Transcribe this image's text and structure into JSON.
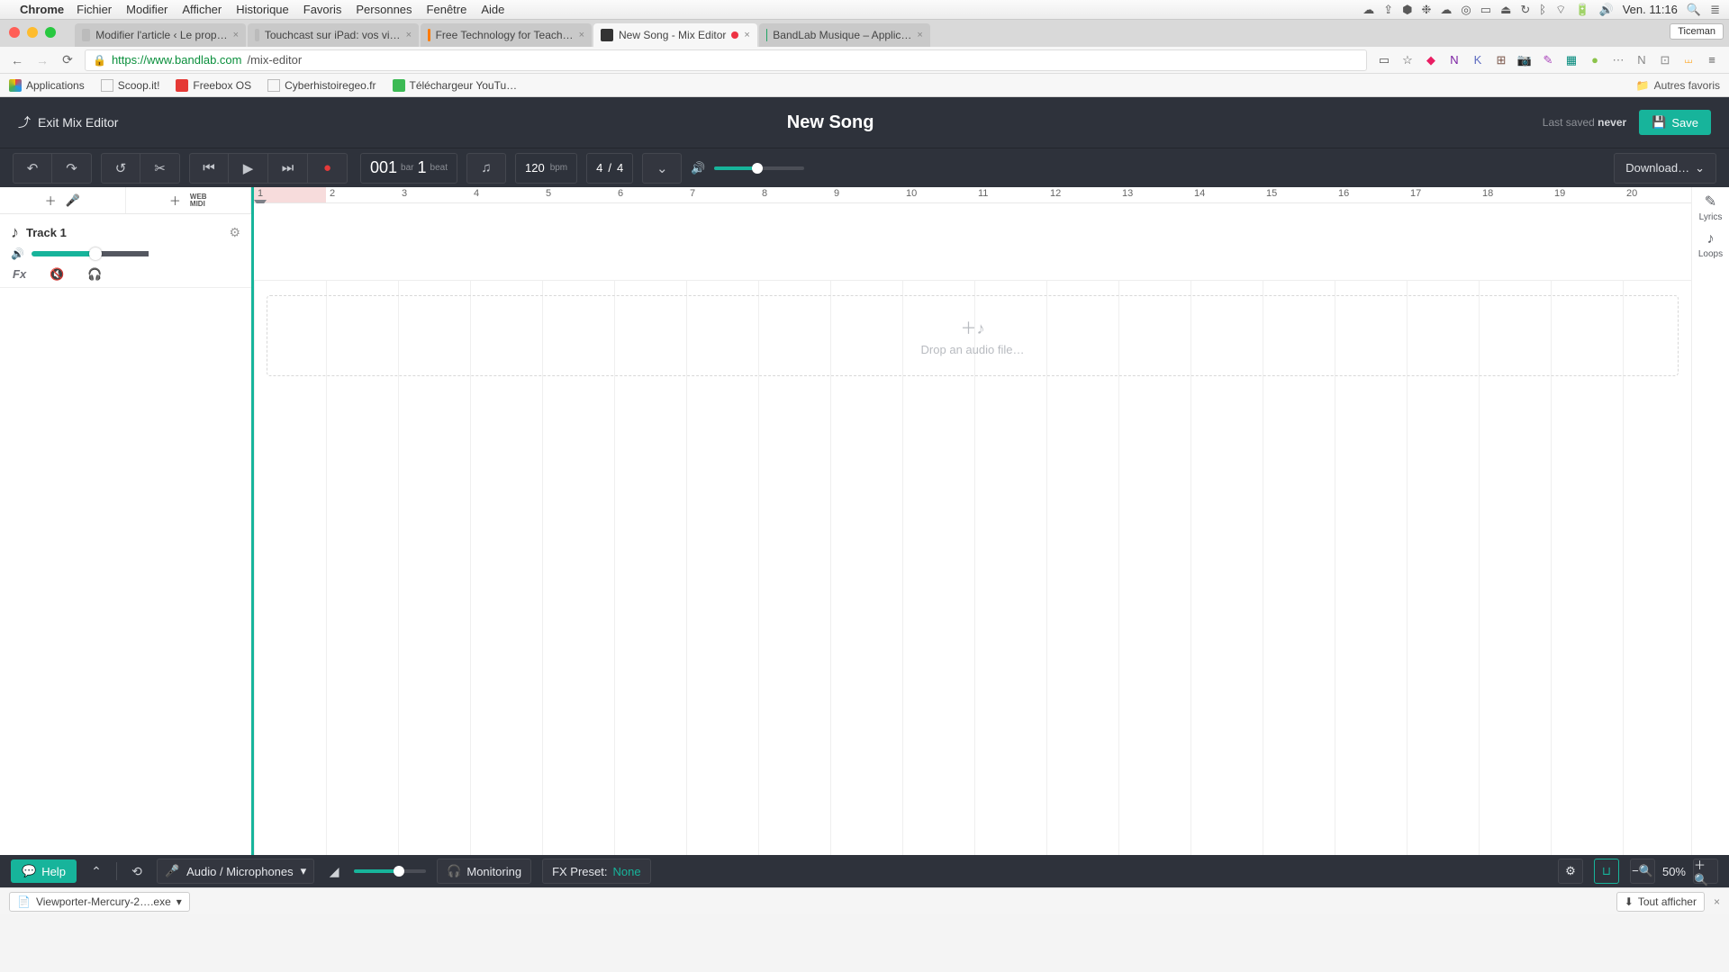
{
  "mac": {
    "app": "Chrome",
    "menus": [
      "Fichier",
      "Modifier",
      "Afficher",
      "Historique",
      "Favoris",
      "Personnes",
      "Fenêtre",
      "Aide"
    ],
    "clock": "Ven. 11:16"
  },
  "chrome": {
    "user": "Ticeman",
    "tabs": [
      {
        "label": "Modifier l'article ‹ Le prop…",
        "fav": "#bbb"
      },
      {
        "label": "Touchcast sur iPad: vos vi…",
        "fav": "#bbb"
      },
      {
        "label": "Free Technology for Teach…",
        "fav": "#ff7b00"
      },
      {
        "label": "New Song - Mix Editor",
        "fav": "#333",
        "active": true,
        "recording": true
      },
      {
        "label": "BandLab Musique – Applic…",
        "fav": "#1fa463"
      }
    ],
    "url_host": "https://www.bandlab.com",
    "url_path": "/mix-editor",
    "bookmarks": [
      {
        "label": "Applications",
        "color": "#4285f4"
      },
      {
        "label": "Scoop.it!",
        "color": "#888"
      },
      {
        "label": "Freebox OS",
        "color": "#e53935"
      },
      {
        "label": "Cyberhistoiregeo.fr",
        "color": "#888"
      },
      {
        "label": "Téléchargeur YouTu…",
        "color": "#3cba54"
      }
    ],
    "other_bookmarks": "Autres favoris",
    "download_file": "Viewporter-Mercury-2….exe",
    "show_all": "Tout afficher"
  },
  "app": {
    "exit_label": "Exit Mix Editor",
    "title": "New Song",
    "last_saved_prefix": "Last saved ",
    "last_saved_value": "never",
    "save_label": "Save",
    "download_label": "Download…",
    "pos_bar": "001",
    "pos_bar_lbl": "bar",
    "pos_beat": "1",
    "pos_beat_lbl": "beat",
    "tempo": "120",
    "tempo_lbl": "bpm",
    "timesig_a": "4",
    "timesig_b": "4",
    "master_volume_pct": 48,
    "ruler_bars": [
      "1",
      "2",
      "3",
      "4",
      "5",
      "6",
      "7",
      "8",
      "9",
      "10",
      "11",
      "12",
      "13",
      "14",
      "15",
      "16",
      "17",
      "18",
      "19",
      "20"
    ],
    "ruler_spacing_px": 80,
    "track1_name": "Track 1",
    "track1_volume_pct": 55,
    "drop_hint": "Drop an audio file…",
    "rail_lyrics": "Lyrics",
    "rail_loops": "Loops",
    "help_label": "Help",
    "audio_select": "Audio / Microphones",
    "monitoring": "Monitoring",
    "fxpreset_label": "FX Preset: ",
    "fxpreset_value": "None",
    "fx_label": "Fx",
    "web_midi_top": "WEB",
    "web_midi_bot": "MIDI",
    "zoom_pct": "50%",
    "bottom_slider_pct": 62
  }
}
